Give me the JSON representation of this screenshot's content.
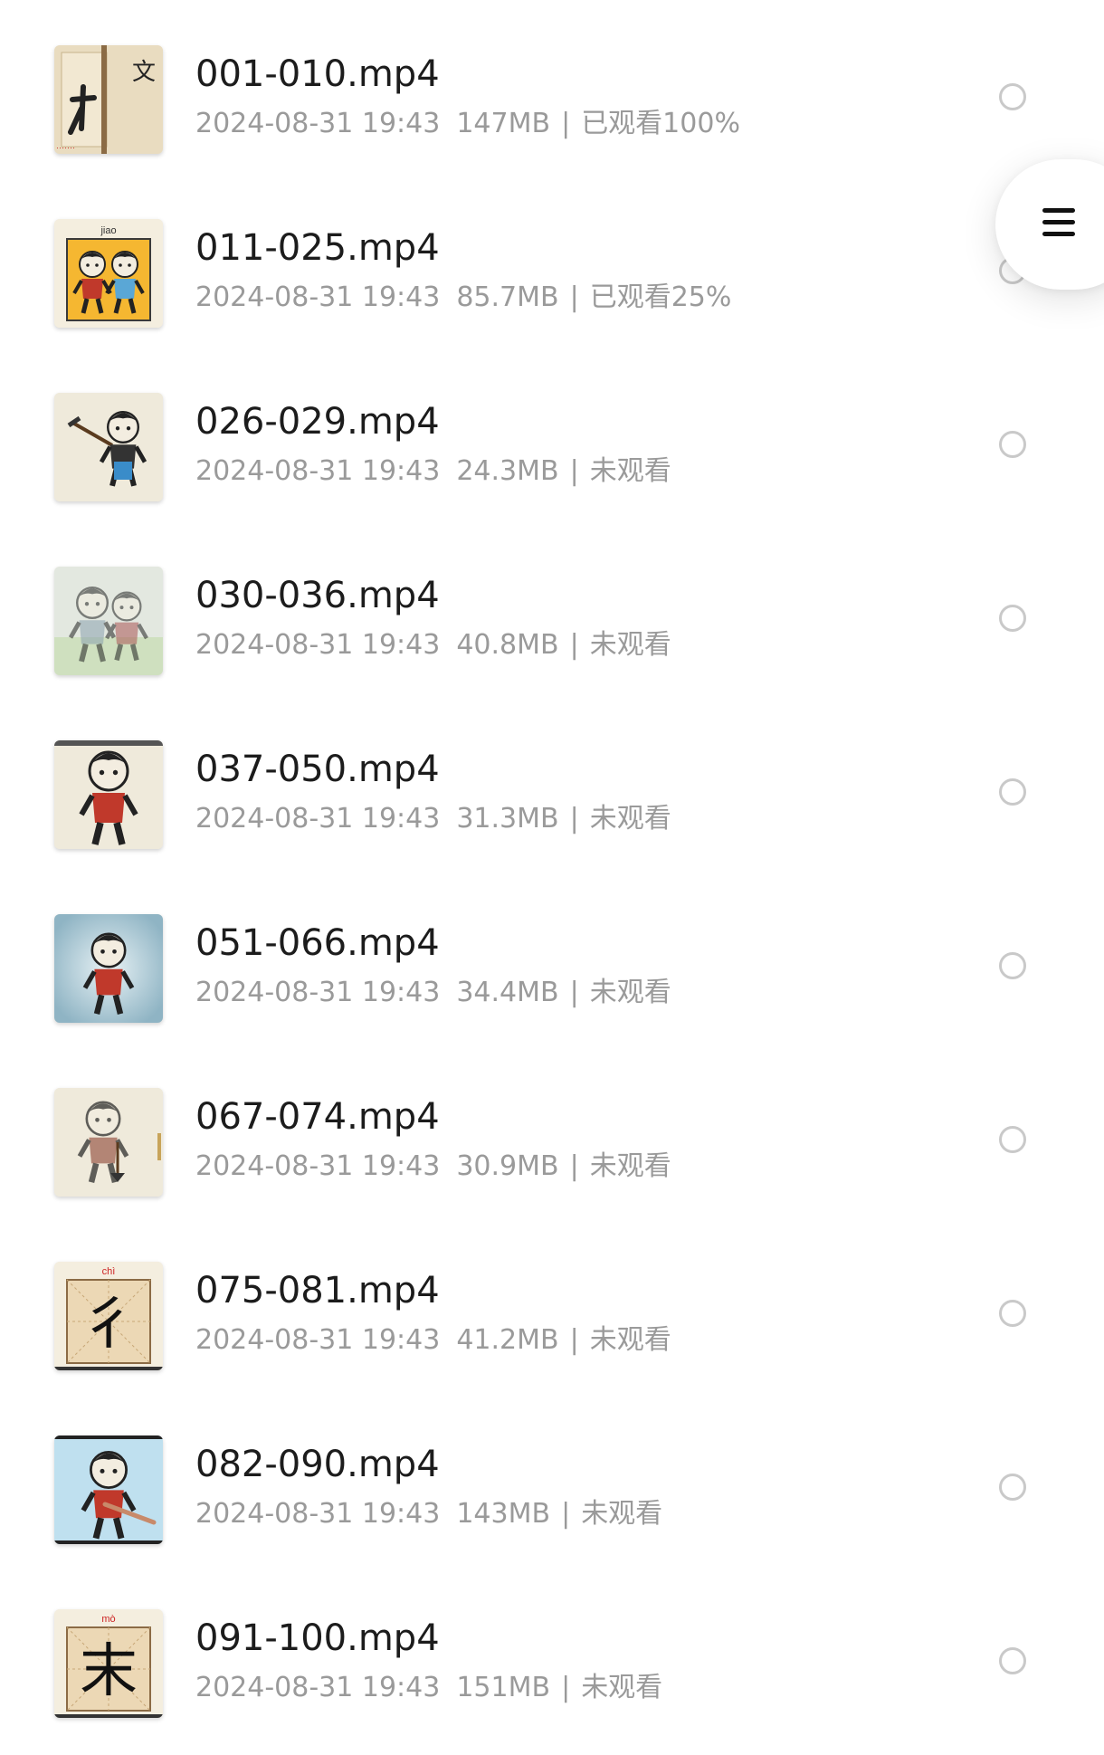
{
  "files": [
    {
      "name": "001-010.mp4",
      "date": "2024-08-31 19:43",
      "size": "147MB",
      "status": "已观看100%",
      "thumb": "calligraphy-scroll",
      "thumb_text": "文"
    },
    {
      "name": "011-025.mp4",
      "date": "2024-08-31 19:43",
      "size": "85.7MB",
      "status": "已观看25%",
      "thumb": "two-children-frame",
      "thumb_text": "jiao"
    },
    {
      "name": "026-029.mp4",
      "date": "2024-08-31 19:43",
      "size": "24.3MB",
      "status": "未观看",
      "thumb": "farmer-with-hoe"
    },
    {
      "name": "030-036.mp4",
      "date": "2024-08-31 19:43",
      "size": "40.8MB",
      "status": "未观看",
      "thumb": "faded-two-figures"
    },
    {
      "name": "037-050.mp4",
      "date": "2024-08-31 19:43",
      "size": "31.3MB",
      "status": "未观看",
      "thumb": "child-standing"
    },
    {
      "name": "051-066.mp4",
      "date": "2024-08-31 19:43",
      "size": "34.4MB",
      "status": "未观看",
      "thumb": "child-blue-vignette"
    },
    {
      "name": "067-074.mp4",
      "date": "2024-08-31 19:43",
      "size": "30.9MB",
      "status": "未观看",
      "thumb": "figure-with-shovel"
    },
    {
      "name": "075-081.mp4",
      "date": "2024-08-31 19:43",
      "size": "41.2MB",
      "status": "未观看",
      "thumb": "character-grid",
      "thumb_text": "chì",
      "thumb_char": "彳"
    },
    {
      "name": "082-090.mp4",
      "date": "2024-08-31 19:43",
      "size": "143MB",
      "status": "未观看",
      "thumb": "child-blue-bg"
    },
    {
      "name": "091-100.mp4",
      "date": "2024-08-31 19:43",
      "size": "151MB",
      "status": "未观看",
      "thumb": "character-grid",
      "thumb_text": "mò",
      "thumb_char": "末"
    }
  ],
  "floating_button": {
    "icon": "menu-icon"
  },
  "colors": {
    "title": "#1c1c1c",
    "meta": "#9a9a9a",
    "radio_border": "#c9c9c9",
    "background": "#ffffff"
  }
}
